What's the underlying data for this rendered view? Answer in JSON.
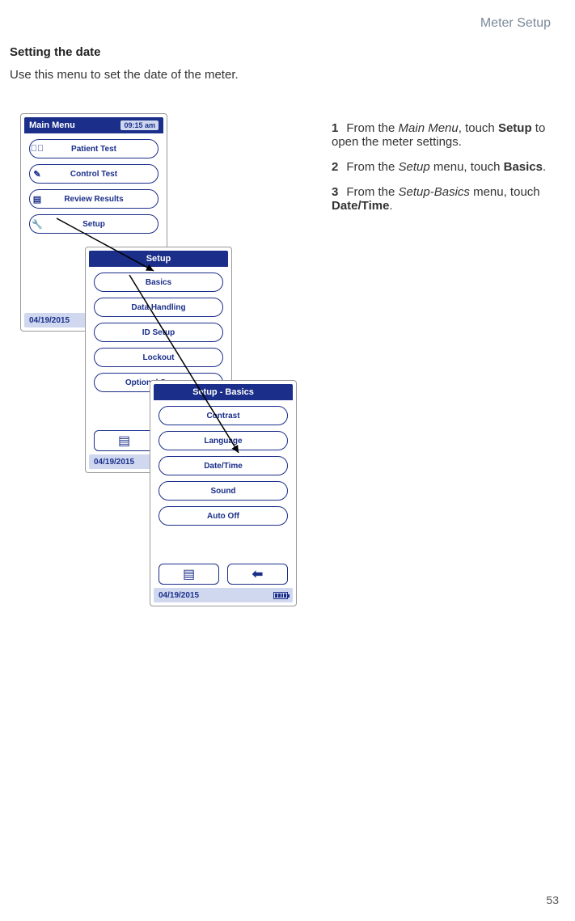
{
  "header": {
    "section": "Meter Setup"
  },
  "title": "Setting the date",
  "intro": "Use this menu to set the date of the meter.",
  "steps": {
    "s1": {
      "num": "1",
      "pre": "From the ",
      "menu": "Main Menu",
      "mid": ", touch ",
      "action": "Setup",
      "post": " to open the meter settings."
    },
    "s2": {
      "num": "2",
      "pre": "From the ",
      "menu": "Setup",
      "mid": " menu, touch ",
      "action": "Basics",
      "post": "."
    },
    "s3": {
      "num": "3",
      "pre": "From the ",
      "menu": "Setup-Basics",
      "mid": " menu, touch ",
      "action": "Date/Time",
      "post": "."
    }
  },
  "device1": {
    "title": "Main Menu",
    "time": "09:15 am",
    "buttons": {
      "b1": "Patient Test",
      "b2": "Control Test",
      "b3": "Review Results",
      "b4": "Setup"
    },
    "footer_date": "04/19/2015"
  },
  "device2": {
    "title": "Setup",
    "buttons": {
      "b1": "Basics",
      "b2": "Data Handling",
      "b3": "ID Setup",
      "b4": "Lockout",
      "b5": "Optional Screens"
    },
    "footer_date": "04/19/2015"
  },
  "device3": {
    "title": "Setup - Basics",
    "buttons": {
      "b1": "Contrast",
      "b2": "Language",
      "b3": "Date/Time",
      "b4": "Sound",
      "b5": "Auto Off"
    },
    "footer_date": "04/19/2015"
  },
  "page_number": "53"
}
